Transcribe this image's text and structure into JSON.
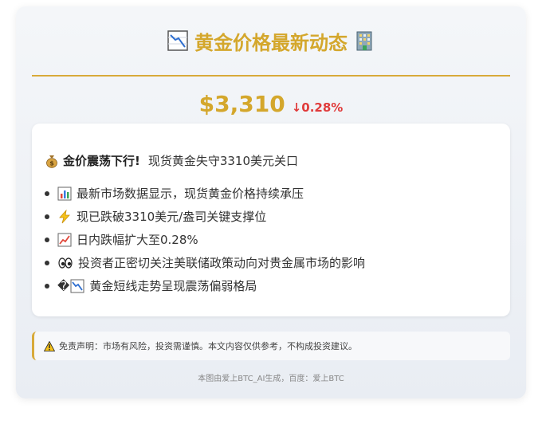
{
  "header": {
    "title": "黄金价格最新动态",
    "left_icon": "chart-decreasing-icon",
    "right_icon": "office-building-icon"
  },
  "price": {
    "value": "$3,310",
    "change": "↓0.28%",
    "price_color": "#d4a72c",
    "change_color": "#e03b3b"
  },
  "news": {
    "headline_icon": "money-bag-icon",
    "headline_strong": "金价震荡下行!",
    "headline_rest": "现货黄金失守3310美元关口",
    "items": [
      {
        "icon": "bar-chart-icon",
        "text": "最新市场数据显示，现货黄金价格持续承压"
      },
      {
        "icon": "lightning-icon",
        "text": "现已跌破3310美元/盎司关键支撑位"
      },
      {
        "icon": "chart-increasing-icon",
        "text": "日内跌幅扩大至0.28%"
      },
      {
        "icon": "eyes-icon",
        "text": "投资者正密切关注美联储政策动向对贵金属市场的影响"
      },
      {
        "icon": "broken-glyph-chart-decreasing-icon",
        "prefix": "�",
        "text": "黄金短线走势呈现震荡偏弱格局"
      }
    ]
  },
  "disclaimer": {
    "icon": "warning-icon",
    "text": "免责声明：市场有风险，投资需谨慎。本文内容仅供参考，不构成投资建议。"
  },
  "footer": {
    "text": "本图由爱上BTC_AI生成，百度：爱上BTC"
  },
  "colors": {
    "accent_gold": "#d8aa3a"
  }
}
